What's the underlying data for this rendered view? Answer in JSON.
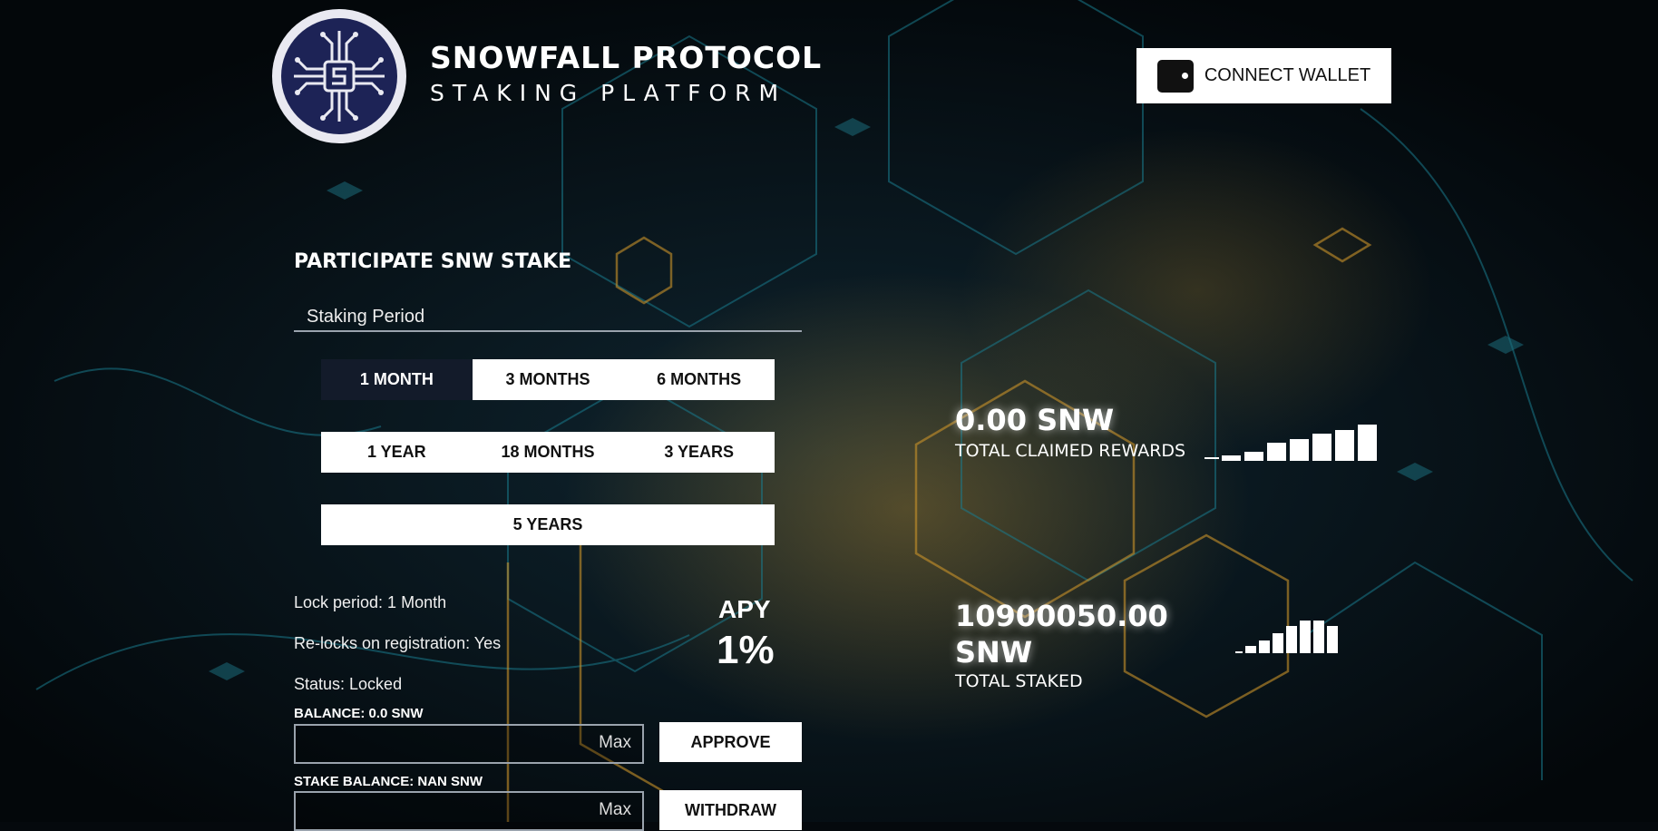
{
  "header": {
    "title": "SNOWFALL PROTOCOL",
    "subtitle": "STAKING PLATFORM",
    "connect_wallet": "CONNECT WALLET"
  },
  "icons": {
    "logo": "circuit-chip-logo",
    "wallet": "wallet-icon",
    "rewards_chart": "bar-chart-icon",
    "staked_chart": "bar-chart-icon"
  },
  "stake": {
    "section_title": "PARTICIPATE SNW STAKE",
    "period_label": "Staking Period",
    "periods": [
      {
        "label": "1 MONTH",
        "active": true
      },
      {
        "label": "3 MONTHS",
        "active": false
      },
      {
        "label": "6 MONTHS",
        "active": false
      },
      {
        "label": "1 YEAR",
        "active": false
      },
      {
        "label": "18 MONTHS",
        "active": false
      },
      {
        "label": "3 YEARS",
        "active": false
      },
      {
        "label": "5 YEARS",
        "active": false
      }
    ],
    "lock_period": "Lock period: 1 Month",
    "relock": "Re-locks on registration: Yes",
    "status": "Status: Locked",
    "apy_label": "APY",
    "apy_value": "1%",
    "balance_label": "BALANCE: 0.0 SNW",
    "stake_balance_label": "STAKE BALANCE: NAN SNW",
    "max_label": "Max",
    "balance_input_value": "",
    "stake_input_value": "",
    "approve_label": "APPROVE",
    "withdraw_label": "WITHDRAW"
  },
  "stats": {
    "rewards_value": "0.00 SNW",
    "rewards_label": "TOTAL CLAIMED REWARDS",
    "staked_value_line1": "10900050.00",
    "staked_value_line2": "SNW",
    "staked_label": "TOTAL STAKED"
  },
  "colors": {
    "background": "#05090d",
    "accent_cyan": "#1a8aa0",
    "accent_gold": "#c9922a",
    "active_button": "#131b2a"
  }
}
